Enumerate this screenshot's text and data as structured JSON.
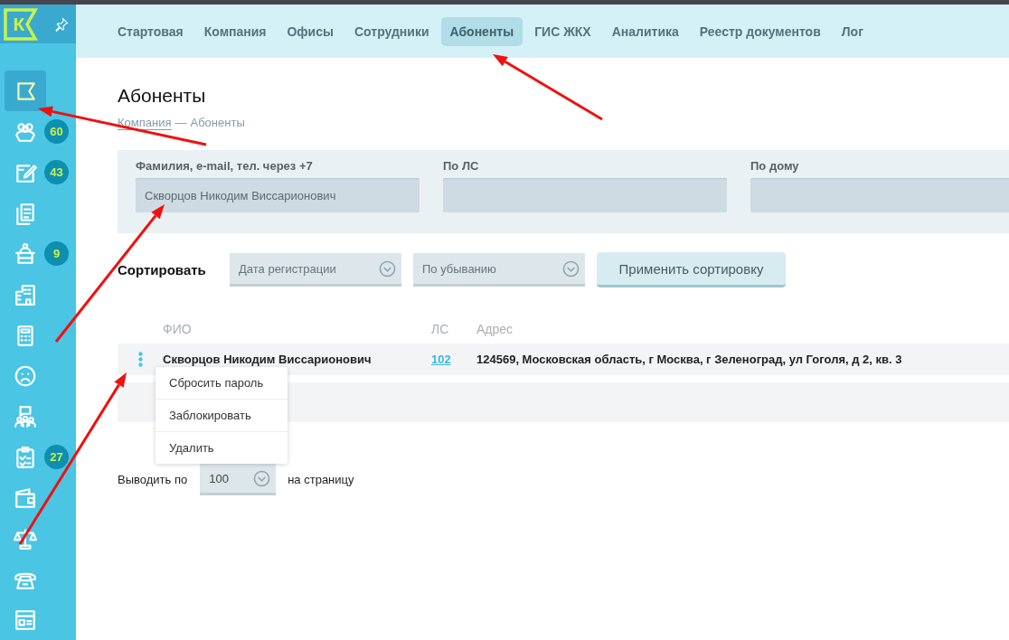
{
  "logo": {
    "letter": "К"
  },
  "sidebar": {
    "items": [
      {
        "selected": true
      },
      {
        "selected": false,
        "badge": "60"
      },
      {
        "selected": false,
        "badge": "43"
      },
      {
        "selected": false
      },
      {
        "selected": false,
        "badge": "9"
      },
      {
        "selected": false
      },
      {
        "selected": false
      },
      {
        "selected": false
      },
      {
        "selected": false
      },
      {
        "selected": false,
        "badge": "27"
      },
      {
        "selected": false
      },
      {
        "selected": false
      },
      {
        "selected": false
      },
      {
        "selected": false
      }
    ]
  },
  "nav": {
    "tabs": [
      {
        "label": "Стартовая",
        "selected": false
      },
      {
        "label": "Компания",
        "selected": false
      },
      {
        "label": "Офисы",
        "selected": false
      },
      {
        "label": "Сотрудники",
        "selected": false
      },
      {
        "label": "Абоненты",
        "selected": true
      },
      {
        "label": "ГИС ЖКХ",
        "selected": false
      },
      {
        "label": "Аналитика",
        "selected": false
      },
      {
        "label": "Реестр документов",
        "selected": false
      },
      {
        "label": "Лог",
        "selected": false
      }
    ]
  },
  "page": {
    "title": "Абоненты",
    "breadcrumb": {
      "link": "Компания",
      "separator": "—",
      "current": "Абоненты"
    }
  },
  "filters": [
    {
      "label": "Фамилия, e-mail, тел. через +7",
      "value": "Скворцов Никодим Виссарионович"
    },
    {
      "label": "По ЛС"
    },
    {
      "label": "По дому"
    }
  ],
  "sort": {
    "label": "Сортировать",
    "fields": [
      {
        "value": "Дата регистрации"
      },
      {
        "value": "По убыванию"
      }
    ],
    "apply_button": "Применить сортировку"
  },
  "table": {
    "columns": [
      "ФИО",
      "ЛС",
      "Адрес"
    ],
    "rows": [
      {
        "name": "Скворцов Никодим Виссарионович",
        "account": "102",
        "address": "124569, Московская область, г Москва, г Зеленоград, ул Гоголя, д 2, кв. 3"
      }
    ]
  },
  "context_menu": {
    "items": [
      "Сбросить пароль",
      "Заблокировать",
      "Удалить"
    ]
  },
  "pagination": {
    "before": "Выводить по",
    "value": "100",
    "after": "на страницу"
  }
}
